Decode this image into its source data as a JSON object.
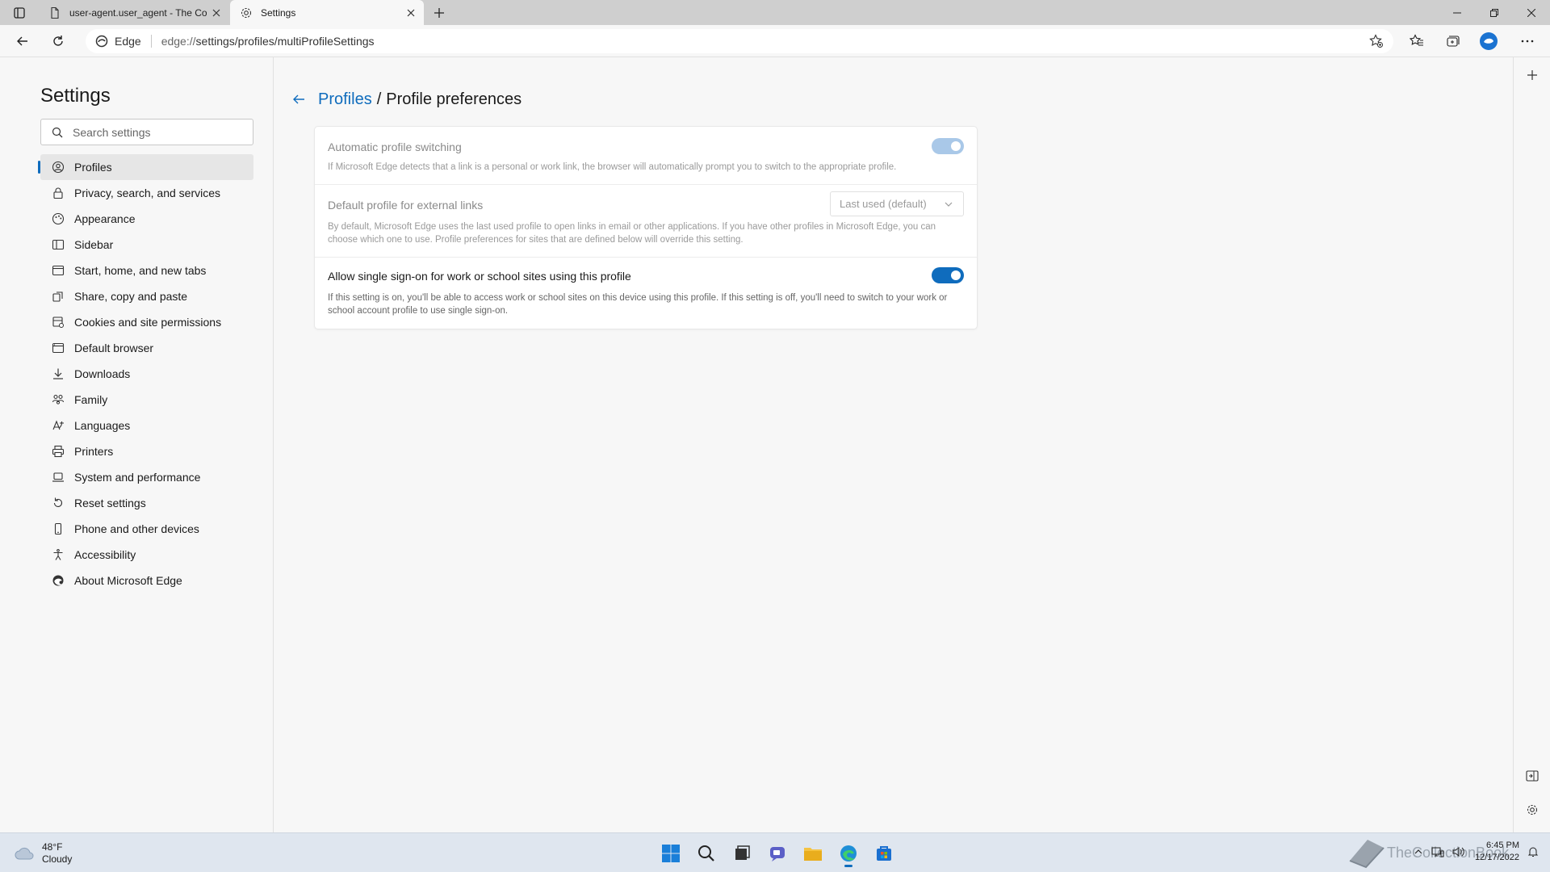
{
  "browser": {
    "tabs": [
      {
        "label": "user-agent.user_agent - The Coll",
        "icon": "document-icon"
      },
      {
        "label": "Settings",
        "icon": "gear-icon"
      }
    ],
    "address": {
      "site_label": "Edge",
      "url_prefix": "edge://",
      "url_rest": "settings/profiles/multiProfileSettings"
    }
  },
  "sidebar": {
    "title": "Settings",
    "search_placeholder": "Search settings",
    "items": [
      {
        "label": "Profiles",
        "icon": "profile-icon",
        "active": true
      },
      {
        "label": "Privacy, search, and services",
        "icon": "lock-icon"
      },
      {
        "label": "Appearance",
        "icon": "appearance-icon"
      },
      {
        "label": "Sidebar",
        "icon": "sidebar-icon"
      },
      {
        "label": "Start, home, and new tabs",
        "icon": "home-icon"
      },
      {
        "label": "Share, copy and paste",
        "icon": "share-icon"
      },
      {
        "label": "Cookies and site permissions",
        "icon": "cookie-icon"
      },
      {
        "label": "Default browser",
        "icon": "browser-icon"
      },
      {
        "label": "Downloads",
        "icon": "download-icon"
      },
      {
        "label": "Family",
        "icon": "family-icon"
      },
      {
        "label": "Languages",
        "icon": "language-icon"
      },
      {
        "label": "Printers",
        "icon": "printer-icon"
      },
      {
        "label": "System and performance",
        "icon": "laptop-icon"
      },
      {
        "label": "Reset settings",
        "icon": "reset-icon"
      },
      {
        "label": "Phone and other devices",
        "icon": "phone-icon"
      },
      {
        "label": "Accessibility",
        "icon": "accessibility-icon"
      },
      {
        "label": "About Microsoft Edge",
        "icon": "edge-icon"
      }
    ]
  },
  "main": {
    "breadcrumb": {
      "parent": "Profiles",
      "separator": "/",
      "current": "Profile preferences"
    },
    "settings": [
      {
        "title": "Automatic profile switching",
        "description": "If Microsoft Edge detects that a link is a personal or work link, the browser will automatically prompt you to switch to the appropriate profile.",
        "control": "toggle",
        "on": true,
        "disabled": true
      },
      {
        "title": "Default profile for external links",
        "description": "By default, Microsoft Edge uses the last used profile to open links in email or other applications. If you have other profiles in Microsoft Edge, you can choose which one to use. Profile preferences for sites that are defined below will override this setting.",
        "control": "dropdown",
        "value": "Last used (default)",
        "disabled": true
      },
      {
        "title": "Allow single sign-on for work or school sites using this profile",
        "description": "If this setting is on, you'll be able to access work or school sites on this device using this profile. If this setting is off, you'll need to switch to your work or school account profile to use single sign-on.",
        "control": "toggle",
        "on": true,
        "disabled": false
      }
    ]
  },
  "taskbar": {
    "weather": {
      "temp": "48°F",
      "condition": "Cloudy"
    },
    "clock": {
      "time": "6:45 PM",
      "date": "12/17/2022"
    },
    "watermark": "TheCollectionBook"
  },
  "colors": {
    "accent": "#0f6cbd",
    "toggle_disabled": "#a9c8e8"
  }
}
